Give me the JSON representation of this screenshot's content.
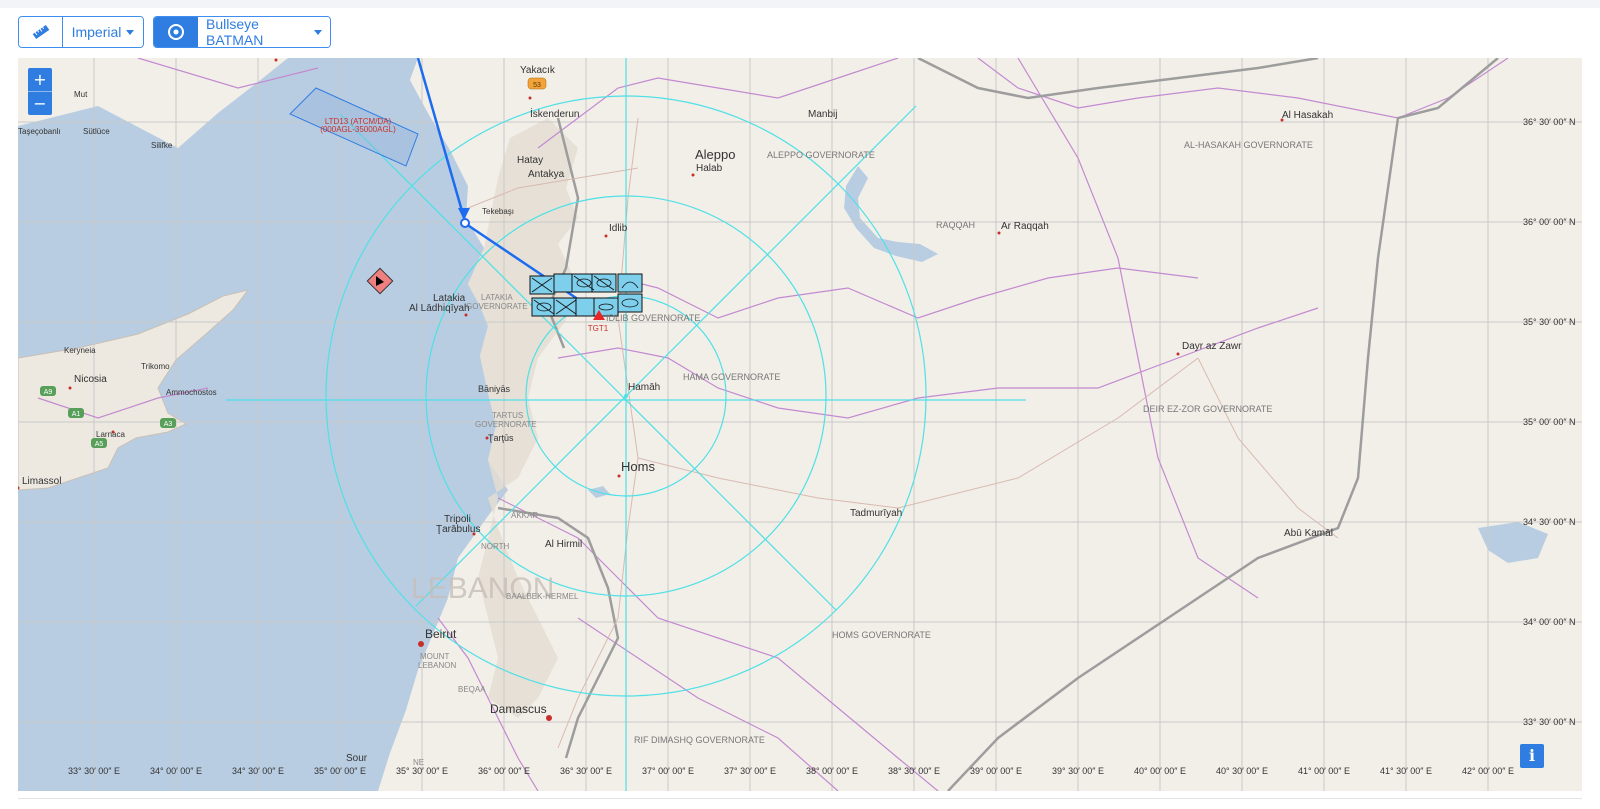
{
  "toolbar": {
    "units_icon": "ruler-icon",
    "units_label": "Imperial",
    "bullseye_icon": "target-icon",
    "bullseye_label": "Bullseye BATMAN"
  },
  "map": {
    "zoom_in": "+",
    "zoom_out": "−",
    "info": "i",
    "colors": {
      "sea": "#b9cde2",
      "land": "#f2efe9",
      "rings": "#4fe0e6",
      "route": "#1d6cf0",
      "target": "#e8262a"
    },
    "places": {
      "yakacik": "Yakacık",
      "route53": "53",
      "iskenderun": "İskenderun",
      "manbij": "Manbij",
      "al_hasakah": "Al Hasakah",
      "al_hasakah_gov": "AL-HASAKAH GOVERNORATE",
      "aleppo": "Aleppo",
      "halab": "Halab",
      "aleppo_gov": "ALEPPO GOVERNORATE",
      "hatay": "Hatay",
      "antakya": "Antakya",
      "tekebasi": "Tekebaşı",
      "idlib": "Idlib",
      "raqqah": "RAQQAH",
      "ar_raqqah": "Ar Raqqah",
      "mut": "Mut",
      "silifke": "Silifke",
      "tasecobanli": "Taşeçobanlı",
      "sutluce": "Sütlüce",
      "latakia": "Latakia",
      "al_ladhiqiyah": "Al Lādhiqīyah",
      "latakia_gov_1": "LATAKIA",
      "latakia_gov_2": "GOVERNORATE",
      "idlib_gov": "IDLIB GOVERNORATE",
      "dayr_az_zawr": "Dayr az Zawr",
      "deir_gov": "DEIR EZ-ZOR GOVERNORATE",
      "keryneia": "Keryneia",
      "trikomo": "Trikomo",
      "nicosia": "Nicosia",
      "ammochostos": "Ammochostos",
      "a9": "A9",
      "a1": "A1",
      "a3": "A3",
      "a5": "A5",
      "larnaca": "Larnaca",
      "limassol": "Limassol",
      "baniyas": "Bāniyās",
      "hamah": "Hamāh",
      "hama_gov": "HAMA GOVERNORATE",
      "tartus_gov_1": "TARTUS",
      "tartus_gov_2": "GOVERNORATE",
      "tartus": "Ţarţūs",
      "homs": "Homs",
      "tadmuriyah": "Tadmurīyah",
      "abu_kamal": "Abū Kamāl",
      "tripoli": "Tripoli",
      "tarabulus": "Ţarābulus",
      "akkar": "AKKAR",
      "north": "NORTH",
      "al_hirmil": "Al Hirmil",
      "lebanon": "LEBANON",
      "baalbek": "BAALBEK-HERMEL",
      "homs_gov": "HOMS GOVERNORATE",
      "beirut": "Beirut",
      "mount_1": "MOUNT",
      "mount_2": "LEBANON",
      "beqaa": "BEQAA",
      "damascus": "Damascus",
      "rif_dimashq": "RIF DIMASHQ GOVERNORATE",
      "sour": "Sour",
      "ne": "NE"
    },
    "airspace": {
      "line1": "LTD13 (ATCM/DA)",
      "line2": "(000AGL-35000AGL)"
    },
    "target": {
      "label": "TGT1"
    },
    "lat_labels": [
      "36° 30′ 00″ N",
      "36° 00′ 00″ N",
      "35° 30′ 00″ N",
      "35° 00′ 00″ N",
      "34° 30′ 00″ N",
      "34° 00′ 00″ N",
      "33° 30′ 00″ N"
    ],
    "lon_labels": [
      "33° 30′ 00″ E",
      "34° 00′ 00″ E",
      "34° 30′ 00″ E",
      "35° 00′ 00″ E",
      "35° 30′ 00″ E",
      "36° 00′ 00″ E",
      "36° 30′ 00″ E",
      "37° 00′ 00″ E",
      "37° 30′ 00″ E",
      "38° 00′ 00″ E",
      "38° 30′ 00″ E",
      "39° 00′ 00″ E",
      "39° 30′ 00″ E",
      "40° 00′ 00″ E",
      "40° 30′ 00″ E",
      "41° 00′ 00″ E",
      "41° 30′ 00″ E",
      "42° 00′ 00″ E"
    ]
  }
}
